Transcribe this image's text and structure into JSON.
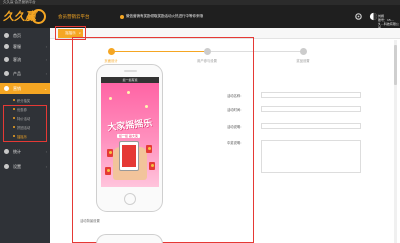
{
  "window": {
    "title": "久久赢·会员营销平台"
  },
  "header": {
    "logo_text": "久久赢",
    "platform_name": "会员营销云平台",
    "notice_text": "微信营销有奖励领取奖励活动火热进行中等你来哦",
    "user_name": "刘娟",
    "user_detail": "账号：15...",
    "user_company": "久...科技有限公司"
  },
  "sidebar": {
    "items": [
      {
        "label": "首页",
        "icon": "home-icon"
      },
      {
        "label": "客服",
        "icon": "service-icon"
      },
      {
        "label": "客流",
        "icon": "traffic-icon"
      },
      {
        "label": "产品",
        "icon": "product-icon"
      },
      {
        "label": "营销",
        "icon": "marketing-icon"
      },
      {
        "label": "统计",
        "icon": "stats-icon"
      },
      {
        "label": "设置",
        "icon": "settings-icon"
      }
    ],
    "sub_items": [
      {
        "label": "积分抽奖"
      },
      {
        "label": "优惠券"
      },
      {
        "label": "特价活动"
      },
      {
        "label": "拼团活动"
      },
      {
        "label": "摇摇乐"
      }
    ]
  },
  "tabs": {
    "active_label": "摇摇乐",
    "close_glyph": "×"
  },
  "stepper": {
    "steps": [
      {
        "label": "页面设计",
        "done": true
      },
      {
        "label": "用户参与设置",
        "done": false
      },
      {
        "label": "奖品设置",
        "done": false
      }
    ]
  },
  "preview": {
    "status_text": "摇一摇有奖",
    "title": "大家摇摇乐",
    "subtitle": "摇一摇 赢大奖",
    "bottom_label": "活动背景设置"
  },
  "form": {
    "fields": [
      {
        "label": "活动名称：",
        "value": ""
      },
      {
        "label": "活动时间：",
        "value": ""
      },
      {
        "label": "活动说明：",
        "value": ""
      },
      {
        "label": "中奖说明：",
        "value": ""
      }
    ]
  },
  "colors": {
    "accent": "#f5a623",
    "highlight": "#e53935",
    "sidebar_bg": "#2f3237"
  }
}
